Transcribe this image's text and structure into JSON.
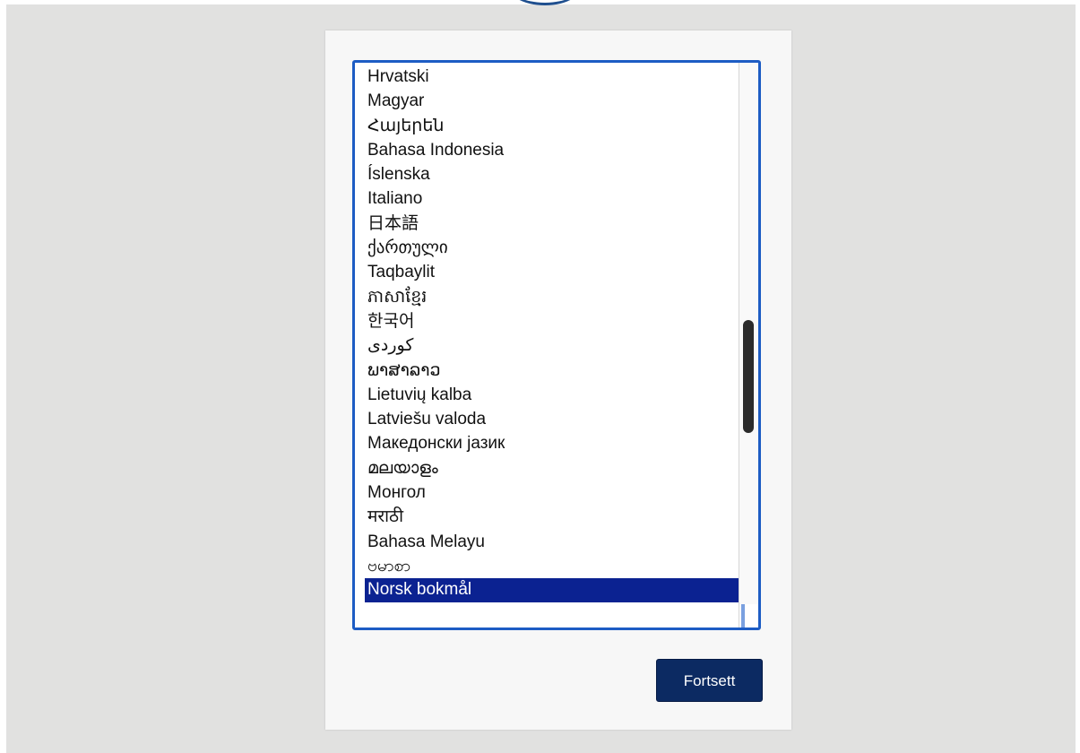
{
  "colors": {
    "backdrop": "#e1e1e0",
    "panel": "#f7f7f7",
    "list_border": "#1d5cc4",
    "selected_bg": "#0b2291",
    "button_bg": "#0c2a62"
  },
  "language_list": {
    "items": [
      "Hrvatski",
      "Magyar",
      "Հայերեն",
      "Bahasa Indonesia",
      "Íslenska",
      "Italiano",
      "日本語",
      "ქართული",
      "Taqbaylit",
      "ភាសាខ្មែរ",
      "한국어",
      "کوردی",
      "ພາສາລາວ",
      "Lietuvių kalba",
      "Latviešu valoda",
      "Македонски јазик",
      "മലയാളം",
      "Монгол",
      "मराठी",
      "Bahasa Melayu",
      "ဗမာစာ"
    ],
    "selected": "Norsk bokmål"
  },
  "continue_button": {
    "label": "Fortsett"
  }
}
